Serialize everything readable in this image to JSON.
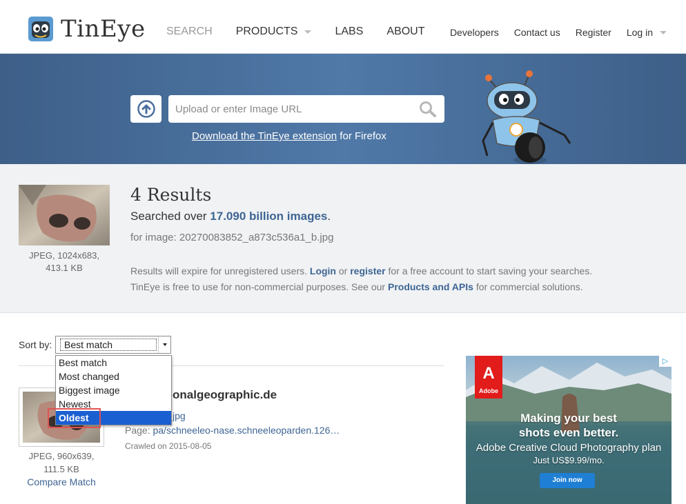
{
  "header": {
    "logo_text": "TinEye",
    "nav": [
      {
        "label": "SEARCH",
        "active": true
      },
      {
        "label": "PRODUCTS",
        "has_caret": true
      },
      {
        "label": "LABS"
      },
      {
        "label": "ABOUT"
      }
    ],
    "right_nav": [
      {
        "label": "Developers"
      },
      {
        "label": "Contact us"
      },
      {
        "label": "Register"
      },
      {
        "label": "Log in",
        "has_caret": true
      }
    ]
  },
  "hero": {
    "search_placeholder": "Upload or enter Image URL",
    "extension_link": "Download the TinEye extension",
    "extension_suffix": " for Firefox"
  },
  "summary": {
    "query_meta_line1": "JPEG, 1024x683,",
    "query_meta_line2": "413.1 KB",
    "results_count": "4 Results",
    "searched_prefix": "Searched over ",
    "searched_count": "17.090 billion images",
    "searched_suffix": ".",
    "for_image": "for image: 20270083852_a873c536a1_b.jpg",
    "expire_1a": "Results will expire for unregistered users. ",
    "expire_login": "Login",
    "expire_or": " or ",
    "expire_register": "register",
    "expire_1b": " for a free account to start saving your searches.",
    "expire_2a": "TinEye is free to use for non-commercial purposes. See our ",
    "expire_products": "Products and APIs",
    "expire_2b": " for commercial solutions."
  },
  "sort": {
    "label": "Sort by:",
    "selected": "Best match",
    "options": [
      "Best match",
      "Most changed",
      "Biggest image",
      "Newest",
      "Oldest"
    ],
    "highlighted": "Oldest"
  },
  "result": {
    "domain": "onalgeographic.de",
    "file": "jpg",
    "page_label": "Page: ",
    "page_url": "pa/schneeleo-nase.schneeleoparden.126…",
    "crawled": "Crawled on 2015-08-05",
    "meta_line1": "JPEG, 960x639,",
    "meta_line2": "111.5 KB",
    "compare": "Compare Match"
  },
  "ad": {
    "brand": "Adobe",
    "headline": "Making your best shots even better.",
    "subhead": "Adobe Creative Cloud Photography plan",
    "price": "Just US$9.99/mo.",
    "cta": "Join now"
  },
  "colors": {
    "hero_blue": "#4a6f9c",
    "link_blue": "#3e6593",
    "select_highlight": "#1a5fd1",
    "annotation_red": "#e05353"
  }
}
